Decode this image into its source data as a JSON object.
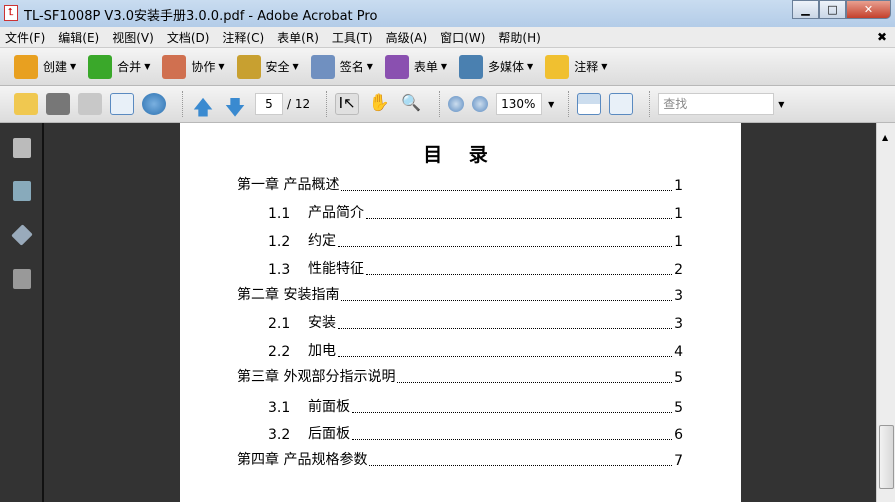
{
  "window": {
    "title": "TL-SF1008P V3.0安装手册3.0.0.pdf - Adobe Acrobat Pro"
  },
  "menu": [
    "文件(F)",
    "编辑(E)",
    "视图(V)",
    "文档(D)",
    "注释(C)",
    "表单(R)",
    "工具(T)",
    "高级(A)",
    "窗口(W)",
    "帮助(H)"
  ],
  "toolbar1": [
    {
      "label": "创建",
      "icon": "create-icon",
      "color": "#e8a020"
    },
    {
      "label": "合并",
      "icon": "combine-icon",
      "color": "#3aa82a"
    },
    {
      "label": "协作",
      "icon": "collaborate-icon",
      "color": "#d07050"
    },
    {
      "label": "安全",
      "icon": "lock-icon",
      "color": "#c8a030"
    },
    {
      "label": "签名",
      "icon": "pen-icon",
      "color": "#7090c0"
    },
    {
      "label": "表单",
      "icon": "form-icon",
      "color": "#8a50b0"
    },
    {
      "label": "多媒体",
      "icon": "multimedia-icon",
      "color": "#4a80b0"
    },
    {
      "label": "注释",
      "icon": "comment-icon",
      "color": "#f0c030"
    }
  ],
  "toolbar2": {
    "page_current": "5",
    "page_total": "/ 12",
    "zoom": "130%",
    "find_placeholder": "查找"
  },
  "document": {
    "title": "目 录",
    "toc": [
      {
        "num": "",
        "label": "第一章  产品概述",
        "page": "1",
        "level": 1
      },
      {
        "num": "1.1",
        "label": "产品简介",
        "page": "1",
        "level": 2
      },
      {
        "num": "1.2",
        "label": "约定",
        "page": "1",
        "level": 2
      },
      {
        "num": "1.3",
        "label": "性能特征",
        "page": "2",
        "level": 2
      },
      {
        "num": "",
        "label": "第二章  安装指南",
        "page": "3",
        "level": 1
      },
      {
        "num": "2.1",
        "label": "安装",
        "page": "3",
        "level": 2
      },
      {
        "num": "2.2",
        "label": "加电",
        "page": "4",
        "level": 2
      },
      {
        "num": "",
        "label": "第三章  外观部分指示说明",
        "page": "5",
        "level": 1
      },
      {
        "num": "3.1",
        "label": "前面板",
        "page": "5",
        "level": 2
      },
      {
        "num": "3.2",
        "label": "后面板",
        "page": "6",
        "level": 2
      },
      {
        "num": "",
        "label": "第四章  产品规格参数",
        "page": "7",
        "level": 1
      }
    ]
  }
}
